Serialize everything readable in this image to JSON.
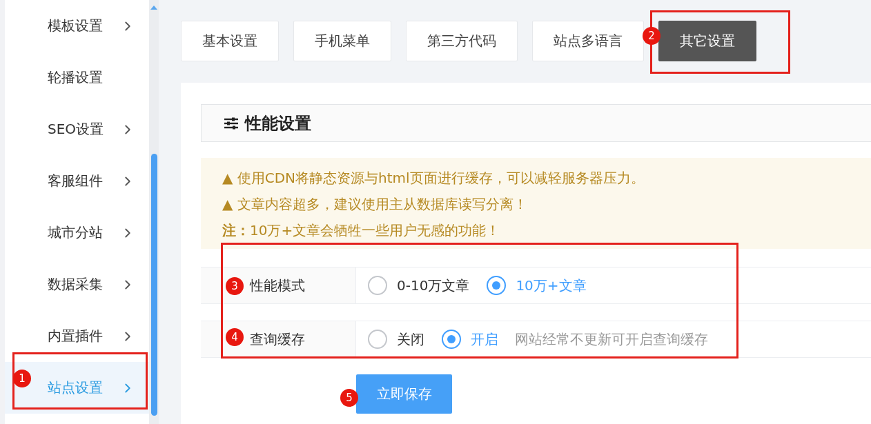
{
  "sidebar": {
    "items": [
      {
        "label": "模板设置",
        "submenu": true,
        "selected": false,
        "outlined": false
      },
      {
        "label": "轮播设置",
        "submenu": false,
        "selected": false,
        "outlined": false
      },
      {
        "label": "SEO设置",
        "submenu": true,
        "selected": false,
        "outlined": false
      },
      {
        "label": "客服组件",
        "submenu": true,
        "selected": false,
        "outlined": false
      },
      {
        "label": "城市分站",
        "submenu": true,
        "selected": false,
        "outlined": false
      },
      {
        "label": "数据采集",
        "submenu": true,
        "selected": false,
        "outlined": false
      },
      {
        "label": "内置插件",
        "submenu": true,
        "selected": false,
        "outlined": false
      },
      {
        "label": "站点设置",
        "submenu": true,
        "selected": true,
        "outlined": true,
        "callout": "1"
      }
    ]
  },
  "tabs": [
    {
      "label": "基本设置",
      "selected": false,
      "outlined": false
    },
    {
      "label": "手机菜单",
      "selected": false,
      "outlined": false
    },
    {
      "label": "第三方代码",
      "selected": false,
      "outlined": false
    },
    {
      "label": "站点多语言",
      "selected": false,
      "outlined": false
    },
    {
      "label": "其它设置",
      "selected": true,
      "outlined": true,
      "callout": "2"
    }
  ],
  "section": {
    "title": "性能设置"
  },
  "notice": {
    "lines": [
      "▲ 使用CDN将静态资源与html页面进行缓存，可以减轻服务器压力。",
      "▲ 文章内容超多，建议使用主从数据库读写分离！",
      "**注：**10万+文章会牺牲一些用户无感的功能！"
    ]
  },
  "form": {
    "outlined": true,
    "rows": [
      {
        "label": "性能模式",
        "callout": "3",
        "options": [
          {
            "label": "0-10万文章",
            "selected": false
          },
          {
            "label": "10万+文章",
            "selected": true
          }
        ]
      },
      {
        "label": "查询缓存",
        "callout": "4",
        "options": [
          {
            "label": "关闭",
            "selected": false
          },
          {
            "label": "开启",
            "selected": true
          }
        ],
        "hint": "网站经常不更新可开启查询缓存"
      }
    ]
  },
  "save_button": {
    "label": "立即保存",
    "callout": "5"
  }
}
